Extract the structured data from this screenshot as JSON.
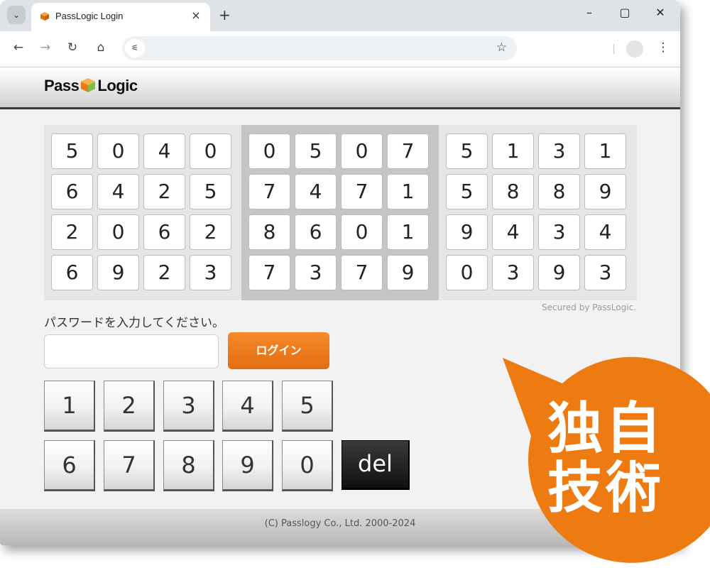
{
  "browser": {
    "tab_title": "PassLogic Login",
    "tab_close": "×",
    "new_tab": "+",
    "window_controls": [
      "–",
      "▢",
      "✕"
    ],
    "nav": {
      "back": "←",
      "forward": "→",
      "reload": "↻",
      "home": "⌂"
    },
    "site_info": "⚟",
    "bookmark_star": "☆",
    "menu": "⋮"
  },
  "header": {
    "logo_left": "Pass",
    "logo_right": "Logic"
  },
  "matrix": {
    "blocks": [
      [
        [
          "5",
          "0",
          "4",
          "0"
        ],
        [
          "6",
          "4",
          "2",
          "5"
        ],
        [
          "2",
          "0",
          "6",
          "2"
        ],
        [
          "6",
          "9",
          "2",
          "3"
        ]
      ],
      [
        [
          "0",
          "5",
          "0",
          "7"
        ],
        [
          "7",
          "4",
          "7",
          "1"
        ],
        [
          "8",
          "6",
          "0",
          "1"
        ],
        [
          "7",
          "3",
          "7",
          "9"
        ]
      ],
      [
        [
          "5",
          "1",
          "3",
          "1"
        ],
        [
          "5",
          "8",
          "8",
          "9"
        ],
        [
          "9",
          "4",
          "3",
          "4"
        ],
        [
          "0",
          "3",
          "9",
          "3"
        ]
      ]
    ],
    "secured_text": "Secured by PassLogic."
  },
  "form": {
    "prompt": "パスワードを入力してください。",
    "password_value": "",
    "login_label": "ログイン"
  },
  "keypad": {
    "row1": [
      "1",
      "2",
      "3",
      "4",
      "5"
    ],
    "row2": [
      "6",
      "7",
      "8",
      "9",
      "0"
    ],
    "del_label": "del"
  },
  "footer": {
    "copyright": "(C) Passlogy Co., Ltd. 2000-2024"
  },
  "badge": {
    "line1": "独自",
    "line2": "技術",
    "color": "#ee7a12"
  },
  "colors": {
    "accent": "#ee7a12",
    "login_button": "#f07c1c"
  }
}
